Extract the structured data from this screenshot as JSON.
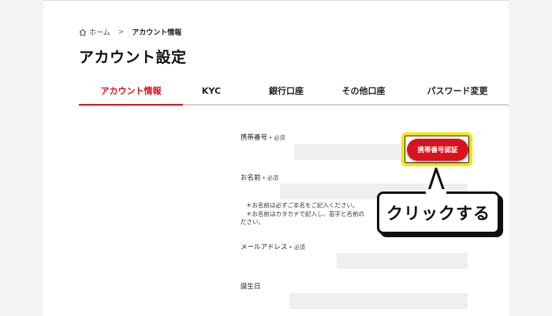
{
  "breadcrumb": {
    "home": "ホーム",
    "separator": ">",
    "current": "アカウント情報"
  },
  "page_title": "アカウント設定",
  "tabs": [
    {
      "label": "アカウント情報",
      "active": true
    },
    {
      "label": "KYC",
      "active": false
    },
    {
      "label": "銀行口座",
      "active": false
    },
    {
      "label": "その他口座",
      "active": false
    },
    {
      "label": "パスワード変更",
      "active": false
    }
  ],
  "form": {
    "phone": {
      "label": "携帯番号",
      "required": "• 必須",
      "value": ""
    },
    "verify_button": "携帯番号認証",
    "name": {
      "label": "お名前",
      "required": "• 必須",
      "value": ""
    },
    "name_notes": [
      "＊お名前は必ずご本名をご記入ください。",
      "＊お名前はカタカナで記入し、苗字と名前の",
      "ださい。"
    ],
    "email": {
      "label": "メールアドレス",
      "required": "• 必須",
      "value": ""
    },
    "birthday": {
      "label": "誕生日",
      "value": ""
    }
  },
  "callout": {
    "text": "クリックする"
  },
  "colors": {
    "accent": "#d9121b",
    "highlight": "#f2e600"
  }
}
